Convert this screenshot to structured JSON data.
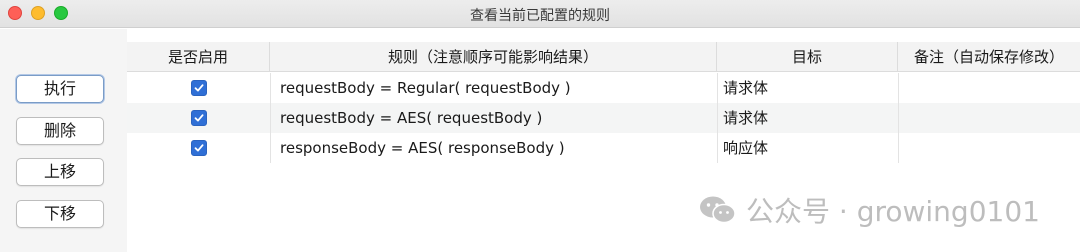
{
  "window": {
    "title": "查看当前已配置的规则"
  },
  "sidebar": {
    "buttons": [
      {
        "label": "执行"
      },
      {
        "label": "删除"
      },
      {
        "label": "上移"
      },
      {
        "label": "下移"
      }
    ]
  },
  "table": {
    "headers": [
      "是否启用",
      "规则（注意顺序可能影响结果）",
      "目标",
      "备注（自动保存修改）"
    ],
    "rows": [
      {
        "enabled": true,
        "rule": "requestBody = Regular( requestBody )",
        "target": "请求体",
        "note": ""
      },
      {
        "enabled": true,
        "rule": "requestBody = AES( requestBody )",
        "target": "请求体",
        "note": ""
      },
      {
        "enabled": true,
        "rule": "responseBody = AES( responseBody )",
        "target": "响应体",
        "note": ""
      }
    ]
  },
  "watermark": {
    "text": "公众号 · growing0101",
    "icon": "wechat-icon"
  },
  "colors": {
    "checkbox": "#2f6fd6",
    "close": "#fe5f57",
    "minimize": "#febc2e",
    "maximize": "#28c840"
  }
}
